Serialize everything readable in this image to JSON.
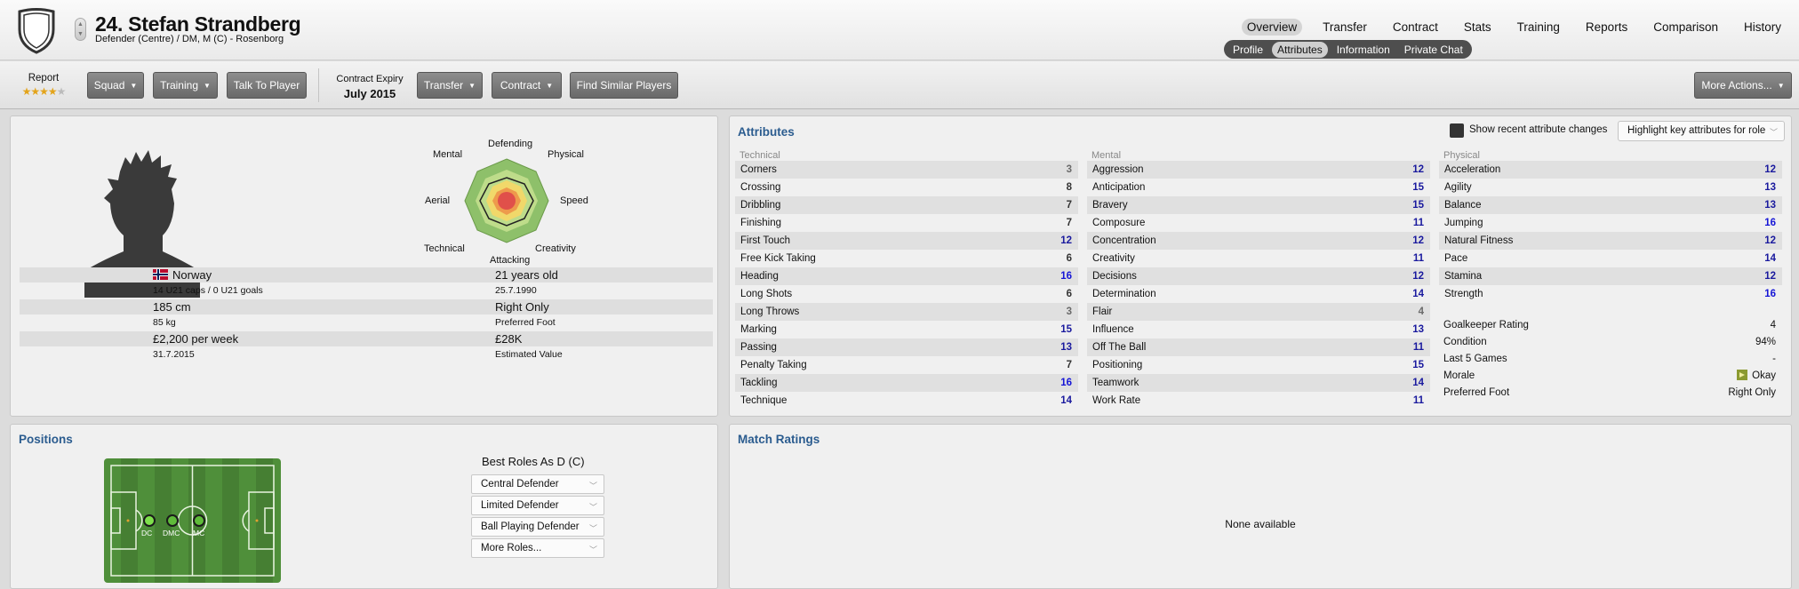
{
  "header": {
    "player_name": "24. Stefan Strandberg",
    "player_sub": "Defender (Centre) / DM, M (C) - Rosenborg",
    "crest_icon": "club-crest-icon",
    "nav": [
      "Overview",
      "Transfer",
      "Contract",
      "Stats",
      "Training",
      "Reports",
      "Comparison",
      "History"
    ],
    "nav_active": "Overview",
    "subnav": [
      "Profile",
      "Attributes",
      "Information",
      "Private Chat"
    ],
    "subnav_active": "Attributes"
  },
  "toolbar": {
    "report_label": "Report",
    "report_stars": 4,
    "report_stars_max": 5,
    "squad": "Squad",
    "training": "Training",
    "talk": "Talk To Player",
    "contract_expiry_label": "Contract Expiry",
    "contract_expiry_value": "July 2015",
    "transfer": "Transfer",
    "contract": "Contract",
    "similar": "Find Similar Players",
    "more_actions": "More Actions..."
  },
  "profile": {
    "radar_labels": {
      "defending": "Defending",
      "physical": "Physical",
      "speed": "Speed",
      "creativity": "Creativity",
      "attacking": "Attacking",
      "technical": "Technical",
      "aerial": "Aerial",
      "mental": "Mental"
    },
    "nationality": "Norway",
    "caps": "14 U21 caps / 0 U21 goals",
    "age": "21 years old",
    "dob": "25.7.1990",
    "height": "185 cm",
    "weight": "85 kg",
    "foot": "Right Only",
    "foot_label": "Preferred Foot",
    "wage": "£2,200 per week",
    "contract_end": "31.7.2015",
    "value": "£28K",
    "value_label": "Estimated Value"
  },
  "attributes": {
    "title": "Attributes",
    "show_changes": "Show recent attribute changes",
    "highlight": "Highlight key attributes for role",
    "technical_title": "Technical",
    "mental_title": "Mental",
    "physical_title": "Physical",
    "technical": [
      {
        "name": "Corners",
        "value": "3",
        "color": "#6a6a6a"
      },
      {
        "name": "Crossing",
        "value": "8",
        "color": "#333333"
      },
      {
        "name": "Dribbling",
        "value": "7",
        "color": "#333333"
      },
      {
        "name": "Finishing",
        "value": "7",
        "color": "#333333"
      },
      {
        "name": "First Touch",
        "value": "12",
        "color": "#1a1a9e"
      },
      {
        "name": "Free Kick Taking",
        "value": "6",
        "color": "#333333"
      },
      {
        "name": "Heading",
        "value": "16",
        "color": "#1515d6"
      },
      {
        "name": "Long Shots",
        "value": "6",
        "color": "#333333"
      },
      {
        "name": "Long Throws",
        "value": "3",
        "color": "#6a6a6a"
      },
      {
        "name": "Marking",
        "value": "15",
        "color": "#1a1a9e"
      },
      {
        "name": "Passing",
        "value": "13",
        "color": "#1a1a9e"
      },
      {
        "name": "Penalty Taking",
        "value": "7",
        "color": "#333333"
      },
      {
        "name": "Tackling",
        "value": "16",
        "color": "#1515d6"
      },
      {
        "name": "Technique",
        "value": "14",
        "color": "#1a1a9e"
      }
    ],
    "mental": [
      {
        "name": "Aggression",
        "value": "12",
        "color": "#1a1a9e"
      },
      {
        "name": "Anticipation",
        "value": "15",
        "color": "#1a1a9e"
      },
      {
        "name": "Bravery",
        "value": "15",
        "color": "#1a1a9e"
      },
      {
        "name": "Composure",
        "value": "11",
        "color": "#1a1a9e"
      },
      {
        "name": "Concentration",
        "value": "12",
        "color": "#1a1a9e"
      },
      {
        "name": "Creativity",
        "value": "11",
        "color": "#1a1a9e"
      },
      {
        "name": "Decisions",
        "value": "12",
        "color": "#1a1a9e"
      },
      {
        "name": "Determination",
        "value": "14",
        "color": "#1a1a9e"
      },
      {
        "name": "Flair",
        "value": "4",
        "color": "#6a6a6a"
      },
      {
        "name": "Influence",
        "value": "13",
        "color": "#1a1a9e"
      },
      {
        "name": "Off The Ball",
        "value": "11",
        "color": "#1a1a9e"
      },
      {
        "name": "Positioning",
        "value": "15",
        "color": "#1a1a9e"
      },
      {
        "name": "Teamwork",
        "value": "14",
        "color": "#1a1a9e"
      },
      {
        "name": "Work Rate",
        "value": "11",
        "color": "#1a1a9e"
      }
    ],
    "physical": [
      {
        "name": "Acceleration",
        "value": "12",
        "color": "#1a1a9e"
      },
      {
        "name": "Agility",
        "value": "13",
        "color": "#1a1a9e"
      },
      {
        "name": "Balance",
        "value": "13",
        "color": "#1a1a9e"
      },
      {
        "name": "Jumping",
        "value": "16",
        "color": "#1515d6"
      },
      {
        "name": "Natural Fitness",
        "value": "12",
        "color": "#1a1a9e"
      },
      {
        "name": "Pace",
        "value": "14",
        "color": "#1a1a9e"
      },
      {
        "name": "Stamina",
        "value": "12",
        "color": "#1a1a9e"
      },
      {
        "name": "Strength",
        "value": "16",
        "color": "#1515d6"
      }
    ],
    "extra": [
      {
        "name": "Goalkeeper Rating",
        "value": "4"
      },
      {
        "name": "Condition",
        "value": "94%"
      },
      {
        "name": "Last 5 Games",
        "value": "-"
      },
      {
        "name": "Morale",
        "value": "Okay"
      },
      {
        "name": "Preferred Foot",
        "value": "Right Only"
      }
    ]
  },
  "positions": {
    "title": "Positions",
    "markers": [
      "DC",
      "DMC",
      "MC"
    ],
    "best_roles_title": "Best Roles As D (C)",
    "roles": [
      "Central Defender",
      "Limited Defender",
      "Ball Playing Defender",
      "More Roles..."
    ]
  },
  "match_ratings": {
    "title": "Match Ratings",
    "empty": "None available"
  }
}
